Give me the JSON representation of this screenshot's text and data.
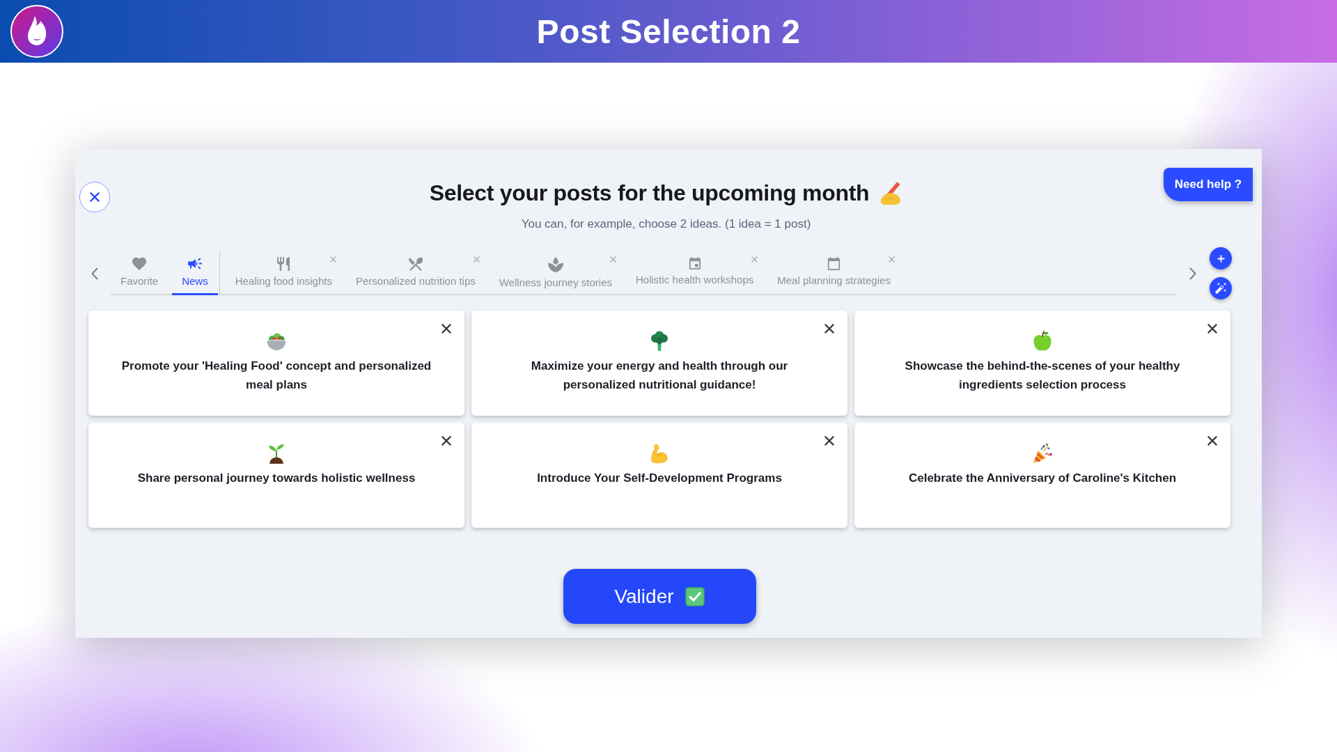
{
  "header": {
    "title": "Post Selection 2"
  },
  "dialog": {
    "title": "Select your posts for the upcoming month",
    "subtitle": "You can, for example, choose 2 ideas. (1 idea = 1 post)",
    "help_button": "Need help ?",
    "tabs": [
      {
        "label": "Favorite",
        "selected": false,
        "closable": false
      },
      {
        "label": "News",
        "selected": true,
        "closable": false
      },
      {
        "label": "Healing food insights",
        "selected": false,
        "closable": true
      },
      {
        "label": "Personalized nutrition tips",
        "selected": false,
        "closable": true
      },
      {
        "label": "Wellness journey stories",
        "selected": false,
        "closable": true
      },
      {
        "label": "Holistic health workshops",
        "selected": false,
        "closable": true
      },
      {
        "label": "Meal planning strategies",
        "selected": false,
        "closable": true
      }
    ],
    "post_ideas": [
      "Promote your 'Healing Food' concept and personalized meal plans",
      "Maximize your energy and health through our personalized nutritional guidance!",
      "Showcase the behind-the-scenes of your healthy ingredients selection process",
      "Share personal journey towards holistic wellness",
      "Introduce Your Self-Development Programs",
      "Celebrate the Anniversary of Caroline's Kitchen"
    ],
    "confirm_button": "Valider"
  }
}
